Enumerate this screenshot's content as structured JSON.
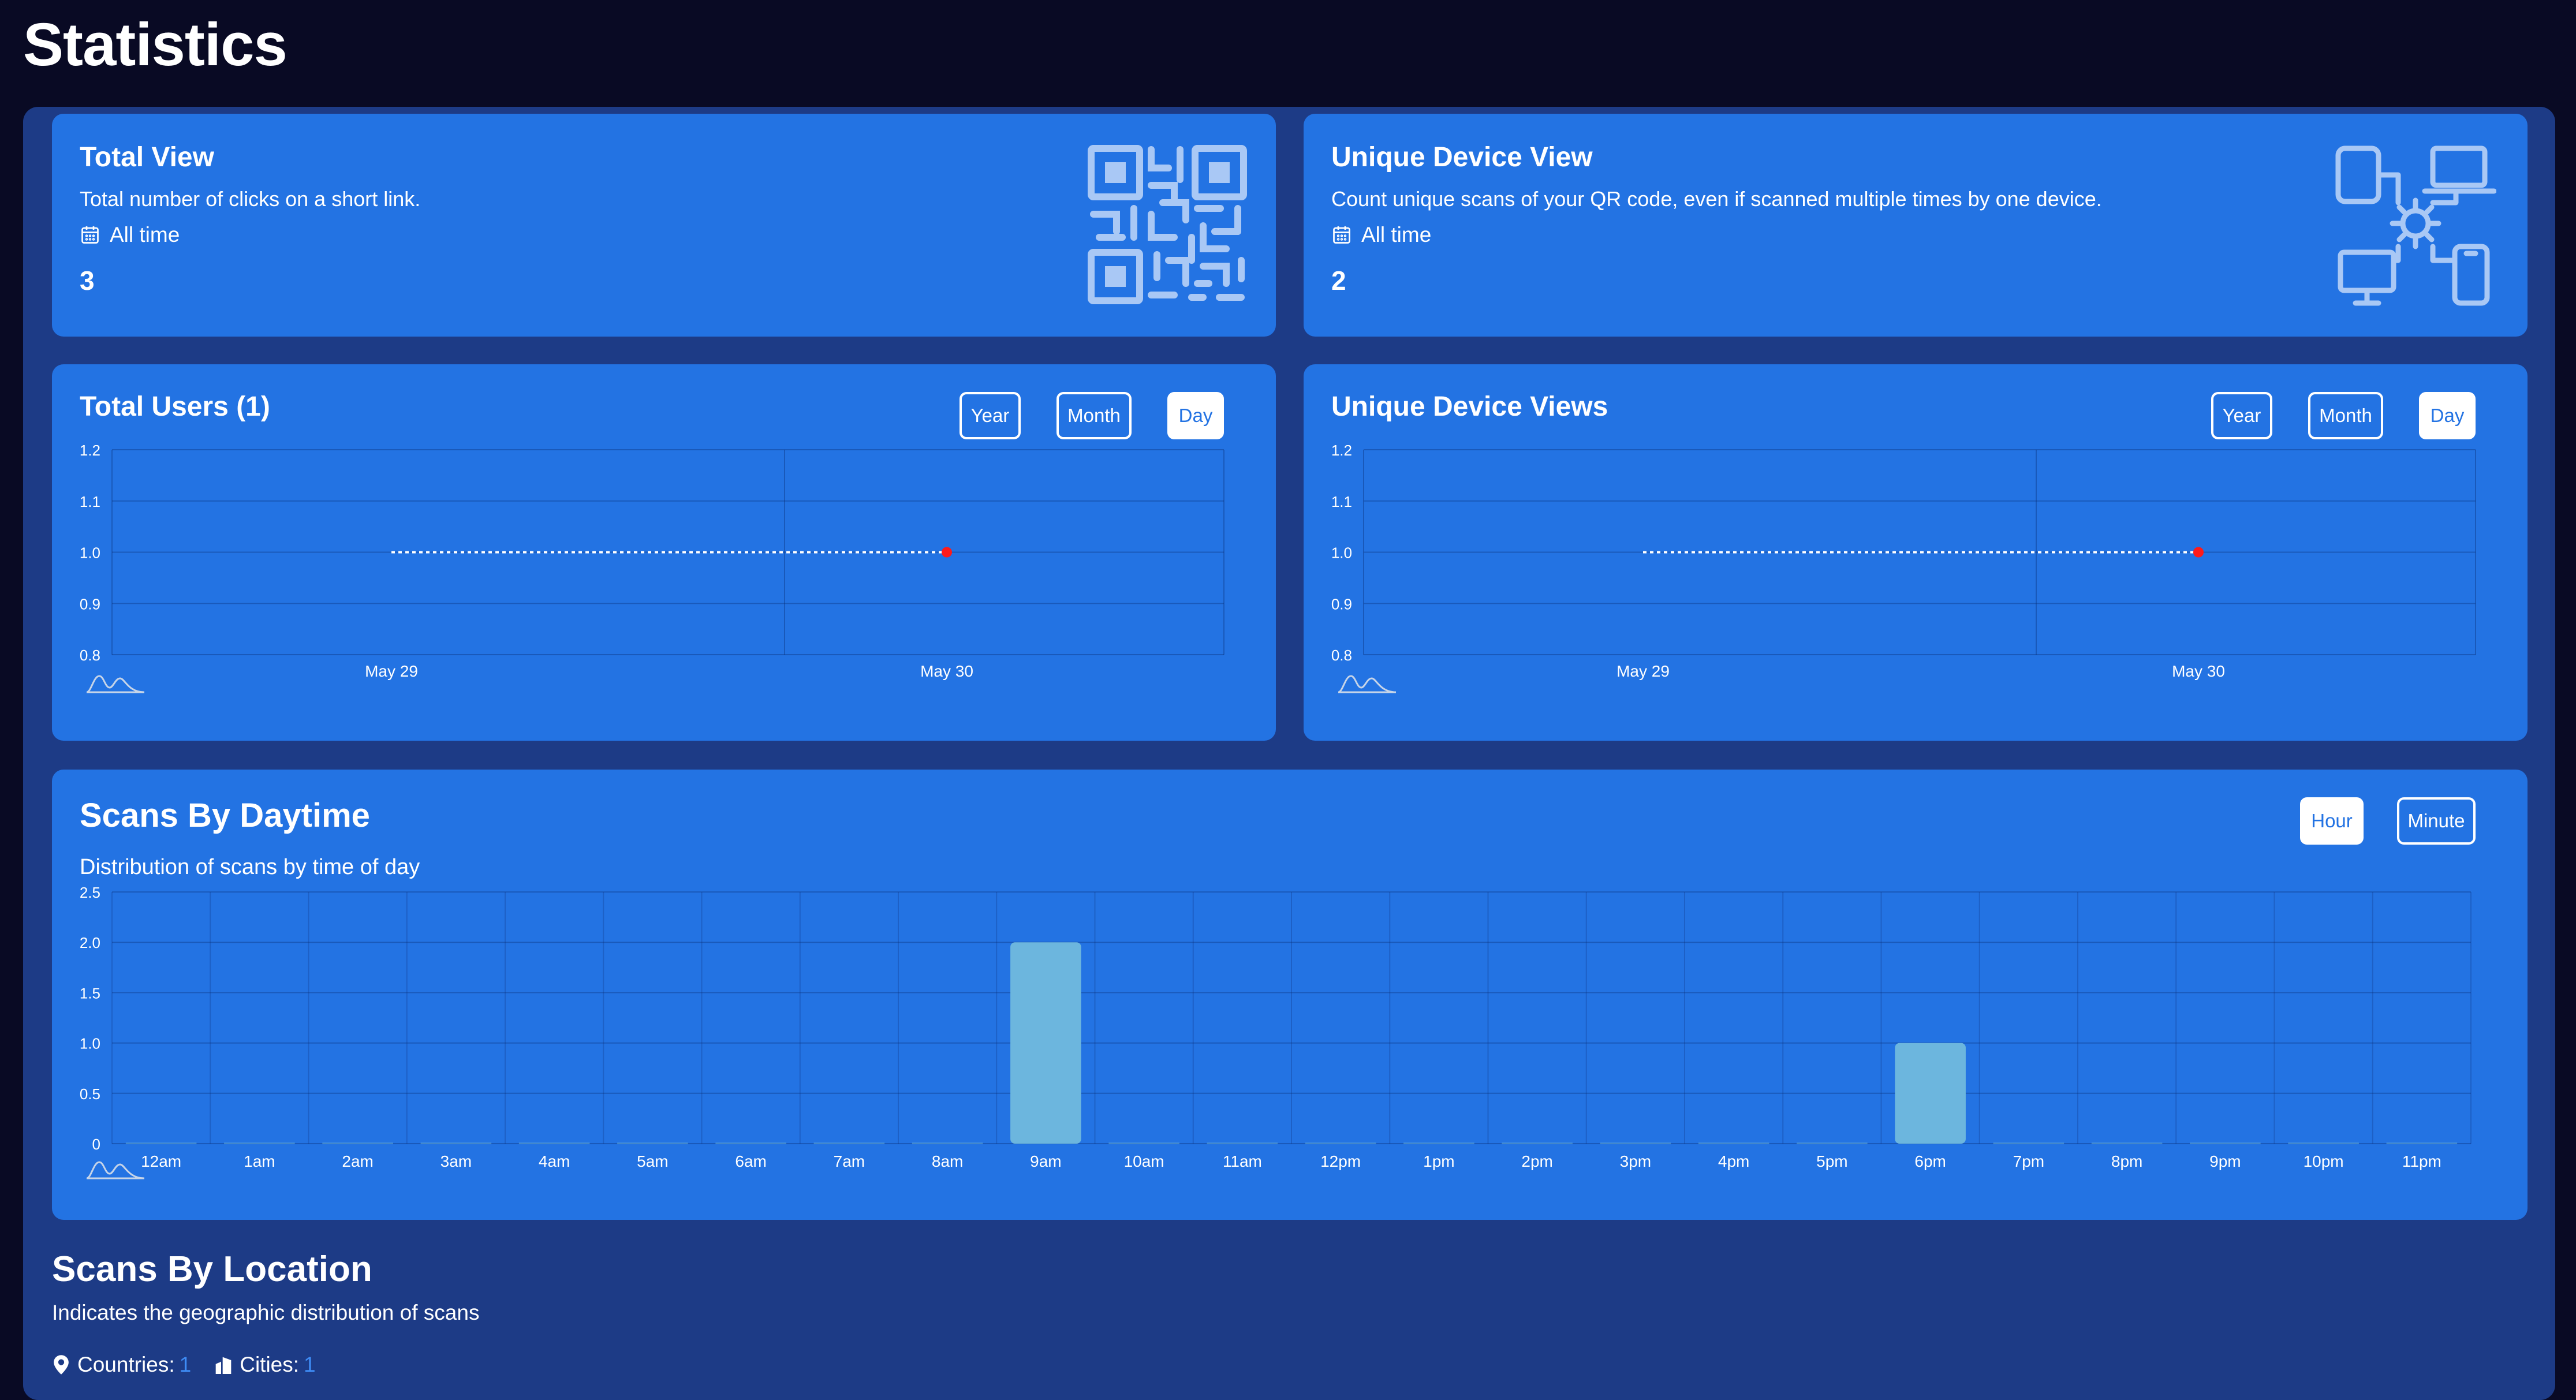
{
  "page": {
    "title": "Statistics"
  },
  "total_view": {
    "title": "Total View",
    "description": "Total number of clicks on a short link.",
    "period": "All time",
    "value": "3",
    "illustration": "qr-code-icon"
  },
  "unique_device_view": {
    "title": "Unique Device View",
    "description": "Count unique scans of your QR code, even if scanned multiple times by one device.",
    "period": "All time",
    "value": "2",
    "illustration": "devices-gear-icon"
  },
  "total_users_chart": {
    "title": "Total Users (1)",
    "buttons": [
      {
        "label": "Year",
        "active": false
      },
      {
        "label": "Month",
        "active": false
      },
      {
        "label": "Day",
        "active": true
      }
    ]
  },
  "unique_device_views_chart": {
    "title": "Unique Device Views",
    "buttons": [
      {
        "label": "Year",
        "active": false
      },
      {
        "label": "Month",
        "active": false
      },
      {
        "label": "Day",
        "active": true
      }
    ]
  },
  "scans_by_daytime": {
    "title": "Scans By Daytime",
    "description": "Distribution of scans by time of day",
    "buttons": [
      {
        "label": "Hour",
        "active": true
      },
      {
        "label": "Minute",
        "active": false
      }
    ]
  },
  "scans_by_location": {
    "title": "Scans By Location",
    "description": "Indicates the geographic distribution of scans",
    "countries_label": "Countries:",
    "countries_value": "1",
    "cities_label": "Cities:",
    "cities_value": "1"
  },
  "colors": {
    "background": "#090a24",
    "panel": "#1d3b86",
    "card": "#2373e3",
    "bar": "#6cb6de",
    "point": "#ff1a1a",
    "link": "#3e8cf5"
  },
  "chart_data": [
    {
      "type": "line",
      "title": "Total Users (1)",
      "x": [
        "May 29",
        "May 30"
      ],
      "series": [
        {
          "values": [
            1.0,
            1.0
          ]
        }
      ],
      "yticks": [
        "1.2",
        "1.1",
        "1.0",
        "0.9",
        "0.8"
      ],
      "ylim": [
        0.8,
        1.2
      ],
      "grid": true
    },
    {
      "type": "line",
      "title": "Unique Device Views",
      "x": [
        "May 29",
        "May 30"
      ],
      "series": [
        {
          "values": [
            1.0,
            1.0
          ]
        }
      ],
      "yticks": [
        "1.2",
        "1.1",
        "1.0",
        "0.9",
        "0.8"
      ],
      "ylim": [
        0.8,
        1.2
      ],
      "grid": true
    },
    {
      "type": "bar",
      "title": "Scans By Daytime",
      "categories": [
        "12am",
        "1am",
        "2am",
        "3am",
        "4am",
        "5am",
        "6am",
        "7am",
        "8am",
        "9am",
        "10am",
        "11am",
        "12pm",
        "1pm",
        "2pm",
        "3pm",
        "4pm",
        "5pm",
        "6pm",
        "7pm",
        "8pm",
        "9pm",
        "10pm",
        "11pm"
      ],
      "values": [
        0,
        0,
        0,
        0,
        0,
        0,
        0,
        0,
        0,
        2,
        0,
        0,
        0,
        0,
        0,
        0,
        0,
        0,
        1,
        0,
        0,
        0,
        0,
        0
      ],
      "yticks": [
        "2.5",
        "2.0",
        "1.5",
        "1.0",
        "0.5",
        "0"
      ],
      "ylim": [
        0,
        2.5
      ],
      "grid": true
    }
  ]
}
